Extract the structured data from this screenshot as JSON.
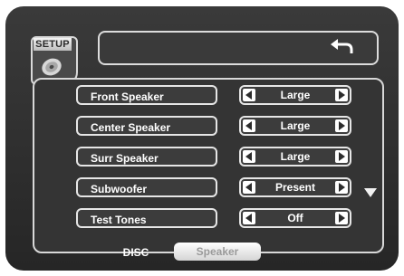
{
  "header": {
    "setup_label": "SETUP"
  },
  "settings": [
    {
      "label": "Front Speaker",
      "value": "Large"
    },
    {
      "label": "Center Speaker",
      "value": "Large"
    },
    {
      "label": "Surr Speaker",
      "value": "Large"
    },
    {
      "label": "Subwoofer",
      "value": "Present"
    },
    {
      "label": "Test Tones",
      "value": "Off"
    }
  ],
  "tabs": [
    {
      "label": "DISC",
      "active": false
    },
    {
      "label": "Speaker",
      "active": true
    }
  ],
  "icons": {
    "setup": "disc-icon",
    "back": "return-arrow-icon",
    "scroll": "scroll-down-icon",
    "prev": "arrow-left-icon",
    "next": "arrow-right-icon"
  },
  "colors": {
    "background": "#2e2e2e",
    "border": "#e6e6e6",
    "text": "#ffffff",
    "active_tab": "#e8e8e8"
  }
}
